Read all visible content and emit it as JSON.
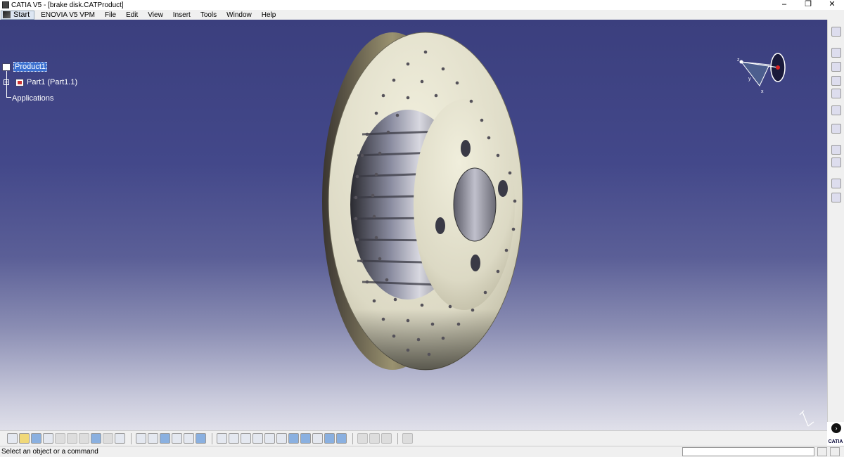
{
  "window": {
    "title": "CATIA V5 - [brake disk.CATProduct]",
    "minimize_label": "–",
    "restore_label": "❐",
    "close_label": "✕"
  },
  "menu": {
    "start": "Start",
    "items": [
      "ENOVIA V5 VPM",
      "File",
      "Edit",
      "View",
      "Insert",
      "Tools",
      "Window",
      "Help"
    ]
  },
  "tree": {
    "root": "Product1",
    "child": "Part1 (Part1.1)",
    "applications": "Applications",
    "expander": "+"
  },
  "compass": {
    "axis_x": "x",
    "axis_y": "y",
    "axis_z": "z"
  },
  "status": {
    "message": "Select an object or a command"
  },
  "logo": {
    "text": "CATIA"
  },
  "colors": {
    "viewport_top": "#3b3f7e",
    "viewport_bottom": "#e0e0ea",
    "selection": "#3a6fcf",
    "disk_face": "#dcd9c4"
  },
  "toolbar_icons": {
    "right": [
      "sketcher-icon",
      "fly-mode-icon",
      "pan-icon",
      "rotate-icon",
      "zoom-icon",
      "normal-view-icon",
      "select-icon",
      "snap-icon",
      "catalog-icon",
      "image-icon",
      "measure-icon",
      "compass-tool-icon"
    ],
    "bottom": [
      "new-icon",
      "open-icon",
      "save-icon",
      "print-icon",
      "cut-icon",
      "copy-icon",
      "paste-icon",
      "undo-icon",
      "redo-icon",
      "whats-this-icon",
      "formula-icon",
      "knowledge-icon",
      "design-table-icon",
      "grid-icon",
      "catalog-browser-icon",
      "properties-icon",
      "fit-all-icon",
      "fly-icon",
      "pan-icon",
      "rotate-icon",
      "zoom-in-icon",
      "zoom-out-icon",
      "normal-view-icon",
      "iso-view-icon",
      "shading-icon",
      "hide-show-icon",
      "swap-space-icon",
      "measure-between-icon",
      "measure-item-icon",
      "analysis-icon",
      "photo-icon"
    ]
  }
}
